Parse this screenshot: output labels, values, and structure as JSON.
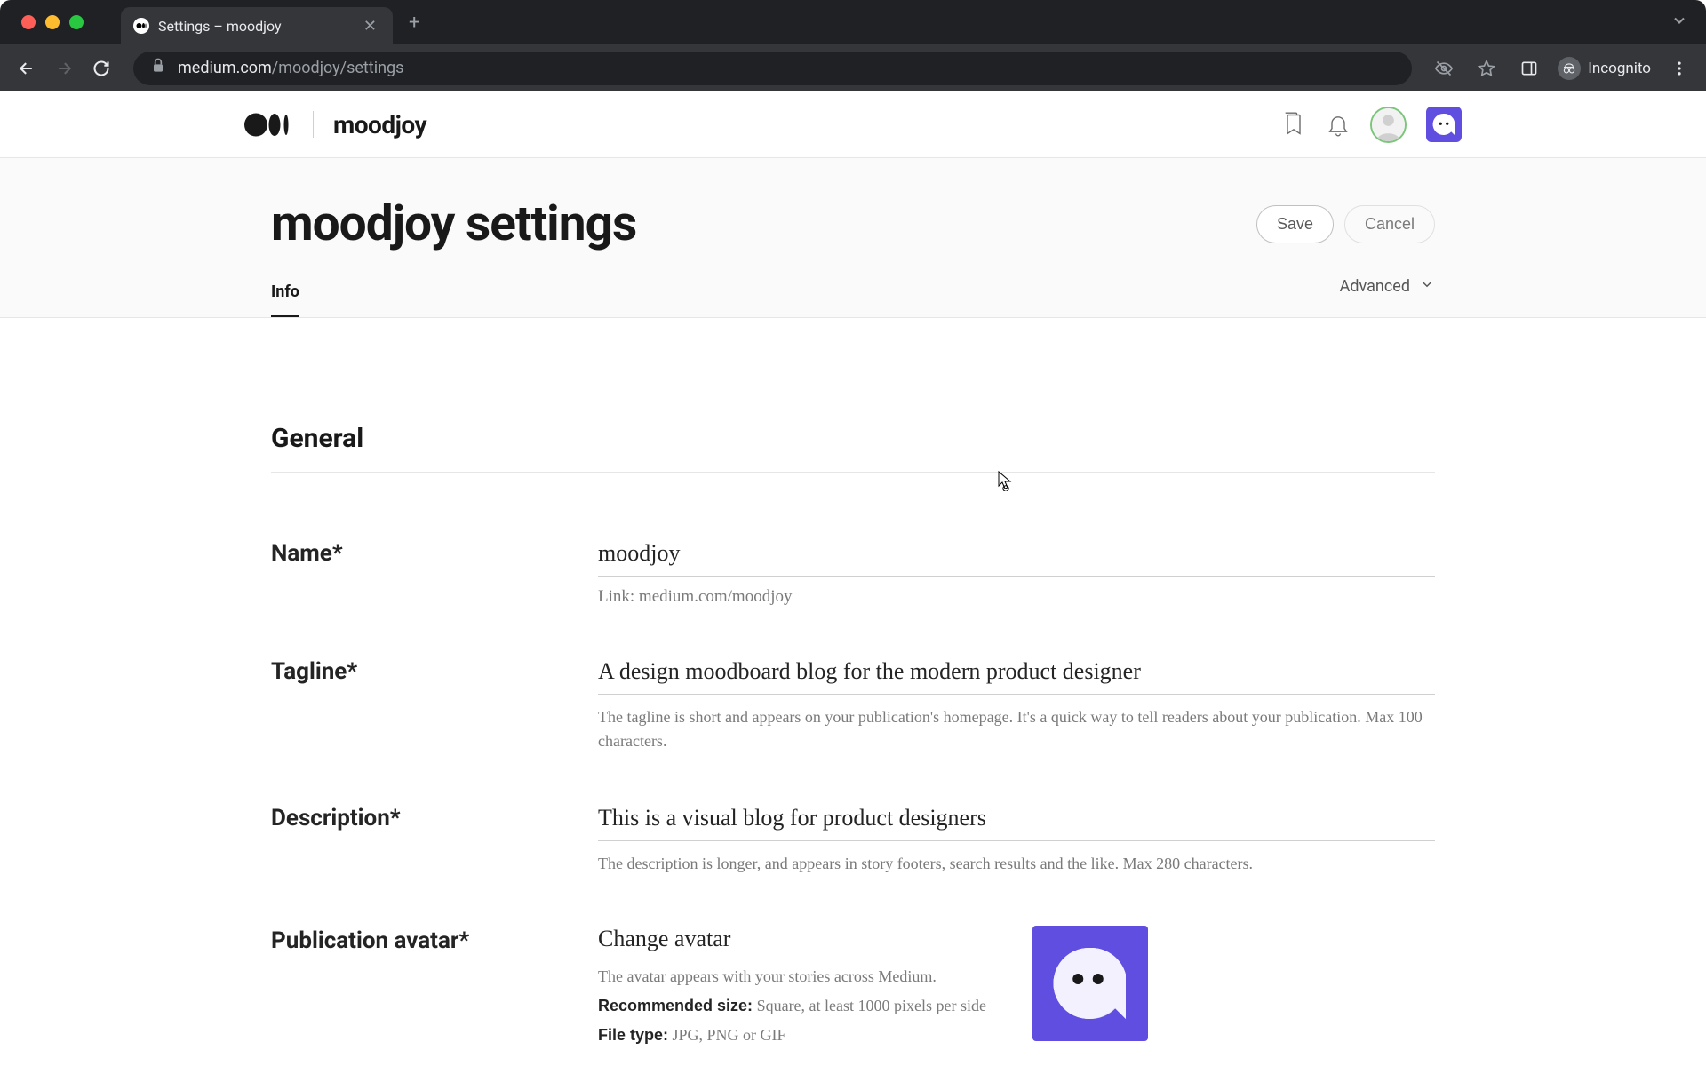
{
  "browser": {
    "tab_title": "Settings – moodjoy",
    "url_host": "medium.com",
    "url_path": "/moodjoy/settings",
    "incognito_label": "Incognito"
  },
  "header": {
    "publication_name": "moodjoy"
  },
  "page": {
    "title": "moodjoy settings",
    "save_label": "Save",
    "cancel_label": "Cancel",
    "tab_info": "Info",
    "advanced_label": "Advanced"
  },
  "section": {
    "general": "General"
  },
  "fields": {
    "name": {
      "label": "Name*",
      "value": "moodjoy",
      "link_prefix": "Link: ",
      "link_value": "medium.com/moodjoy"
    },
    "tagline": {
      "label": "Tagline*",
      "value": "A design moodboard blog for the modern product designer",
      "hint": "The tagline is short and appears on your publication's homepage. It's a quick way to tell readers about your publication. Max 100 characters."
    },
    "description": {
      "label": "Description*",
      "value": "This is a visual blog for product designers",
      "hint": "The description is longer, and appears in story footers, search results and the like. Max 280 characters."
    },
    "avatar": {
      "label": "Publication avatar*",
      "change_label": "Change avatar",
      "hint1": "The avatar appears with your stories across Medium.",
      "rec_label": "Recommended size:",
      "rec_value": " Square, at least 1000 pixels per side",
      "file_label": "File type:",
      "file_value": " JPG, PNG or GIF"
    }
  },
  "colors": {
    "accent": "#5f4ee0"
  }
}
